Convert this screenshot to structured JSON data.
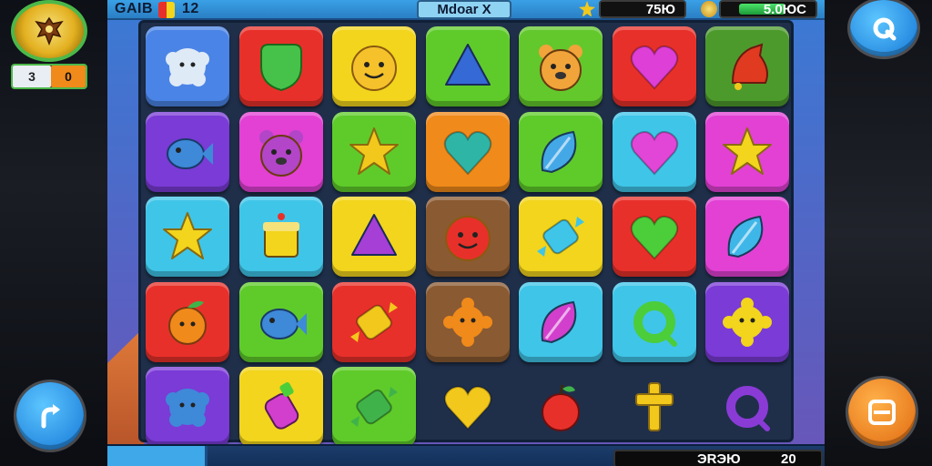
{
  "hud": {
    "top_left_label": "GAIB",
    "top_left_count": "12",
    "mode_label": "Mdoar  X",
    "moves_value": "75Ю",
    "coins_value": "5.0ЮC",
    "coin_bar_fill": 0.78,
    "bottom_left_text": "",
    "bottom_right_label": "ЭRЭЮ",
    "bottom_right_value": "20"
  },
  "player": {
    "badge_left": "3",
    "badge_right": "0"
  },
  "buttons": {
    "top_right_icon": "refresh-icon",
    "bottom_left_icon": "redo-arrow-icon",
    "bottom_right_icon": "menu-icon"
  },
  "board": {
    "rows": 5,
    "cols": 7,
    "tiles": [
      [
        {
          "bg": "#4a84e6",
          "piece": "puff",
          "color": "#dfeaf7"
        },
        {
          "bg": "#e8302a",
          "piece": "shield",
          "color": "#46c24a"
        },
        {
          "bg": "#f2d51c",
          "piece": "face",
          "color": "#f6c22b"
        },
        {
          "bg": "#5fcb2a",
          "piece": "triangle",
          "color": "#3469d6"
        },
        {
          "bg": "#63c82c",
          "piece": "bear",
          "color": "#f0a43a"
        },
        {
          "bg": "#e8302a",
          "piece": "heart",
          "color": "#de3fd6"
        },
        {
          "bg": "#4d9a2c",
          "piece": "bell",
          "color": "#e03a20"
        }
      ],
      [
        {
          "bg": "#7a3bd6",
          "piece": "fish",
          "color": "#3e89d8"
        },
        {
          "bg": "#e241d4",
          "piece": "bear",
          "color": "#b245c8"
        },
        {
          "bg": "#5fcb2a",
          "piece": "star",
          "color": "#f2c81c"
        },
        {
          "bg": "#f08a1a",
          "piece": "heart",
          "color": "#2fb5a6"
        },
        {
          "bg": "#5fcb2a",
          "piece": "leaf",
          "color": "#45a8e6"
        },
        {
          "bg": "#3fc5e8",
          "piece": "heart",
          "color": "#e246d6"
        },
        {
          "bg": "#e241d4",
          "piece": "star",
          "color": "#f2d51c"
        }
      ],
      [
        {
          "bg": "#3fc5e8",
          "piece": "star",
          "color": "#f2d51c"
        },
        {
          "bg": "#3fc5e8",
          "piece": "cake",
          "color": "#f2d51c"
        },
        {
          "bg": "#f2d51c",
          "piece": "triangle",
          "color": "#a63fd6"
        },
        {
          "bg": "#8a5a32",
          "piece": "face",
          "color": "#e8302a"
        },
        {
          "bg": "#f2d51c",
          "piece": "candy",
          "color": "#3fc5e8"
        },
        {
          "bg": "#e8302a",
          "piece": "heart",
          "color": "#4ccd3a"
        },
        {
          "bg": "#e241d4",
          "piece": "leaf",
          "color": "#3fb6e8"
        }
      ],
      [
        {
          "bg": "#e8302a",
          "piece": "fruit",
          "color": "#f08a1a"
        },
        {
          "bg": "#5fcb2a",
          "piece": "fish",
          "color": "#3e89d8"
        },
        {
          "bg": "#e8302a",
          "piece": "candy",
          "color": "#f2c81c"
        },
        {
          "bg": "#8a5a32",
          "piece": "flower",
          "color": "#f08a1a"
        },
        {
          "bg": "#3fc5e8",
          "piece": "leaf",
          "color": "#d23fcc"
        },
        {
          "bg": "#3fc5e8",
          "piece": "ring",
          "color": "#4ccd3a"
        },
        {
          "bg": "#7a3bd6",
          "piece": "flower",
          "color": "#f2d51c"
        }
      ],
      [
        {
          "bg": "#7a3bd6",
          "piece": "puff",
          "color": "#3e89d8"
        },
        {
          "bg": "#f2d51c",
          "piece": "bottle",
          "color": "#d23fcc"
        },
        {
          "bg": "#5fcb2a",
          "piece": "candy",
          "color": "#3fb34a"
        },
        {
          "bg": "none",
          "piece": "heart",
          "color": "#f2c81c"
        },
        {
          "bg": "none",
          "piece": "apple",
          "color": "#e8302a"
        },
        {
          "bg": "none",
          "piece": "cross",
          "color": "#f2c81c"
        },
        {
          "bg": "none",
          "piece": "ring",
          "color": "#8a3bd6"
        }
      ]
    ]
  }
}
